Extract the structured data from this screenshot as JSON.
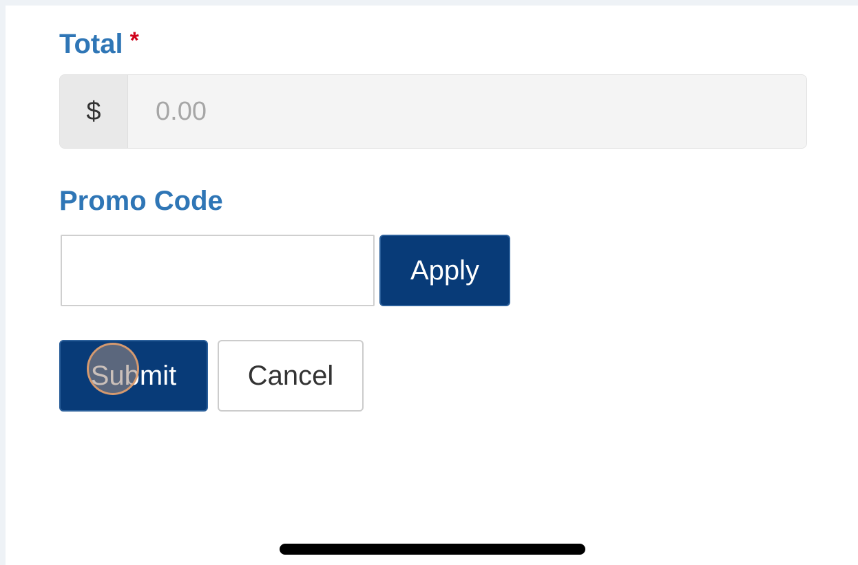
{
  "form": {
    "total": {
      "label": "Total",
      "required_marker": "*",
      "currency_symbol": "$",
      "placeholder": "0.00",
      "value": ""
    },
    "promo": {
      "label": "Promo Code",
      "value": "",
      "apply_label": "Apply"
    },
    "actions": {
      "submit_label": "Submit",
      "cancel_label": "Cancel"
    }
  },
  "colors": {
    "label_blue": "#2f76b6",
    "required_red": "#d0021b",
    "primary_button": "#083b78",
    "page_background": "#eef2f6"
  },
  "icons": {
    "touch_indicator": "touch-point-indicator",
    "home_indicator": "home-bar"
  }
}
